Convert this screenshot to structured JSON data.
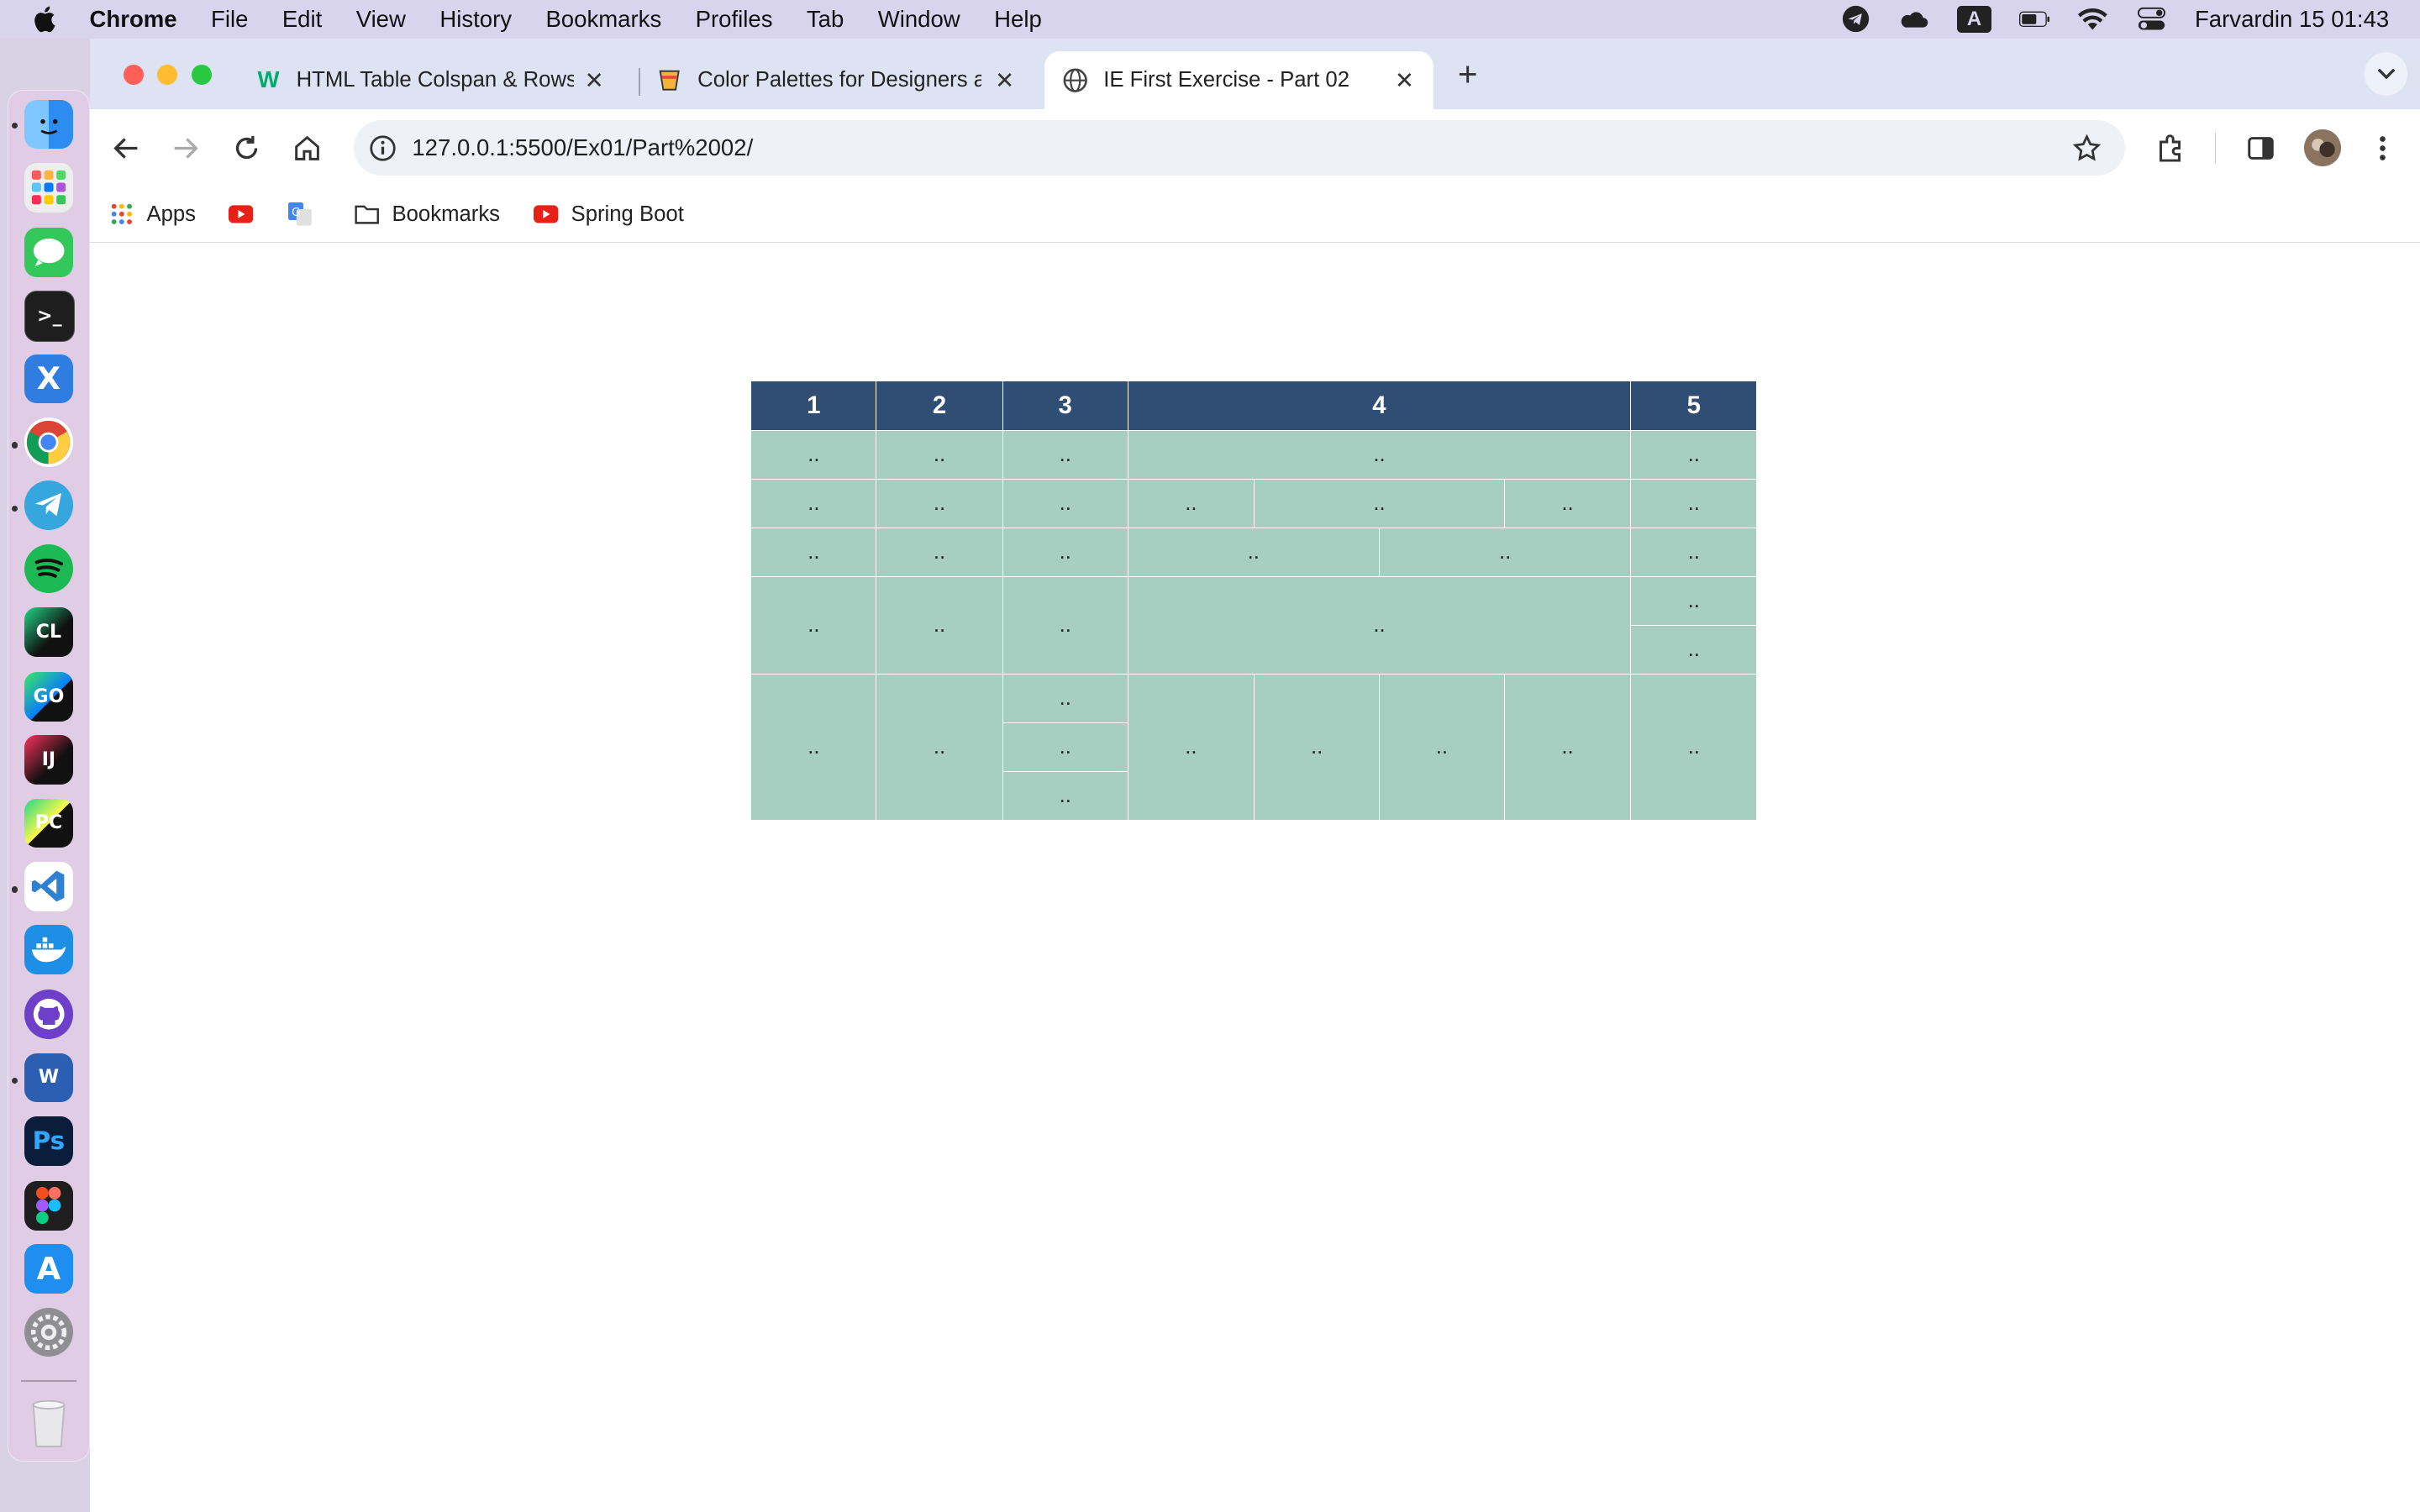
{
  "menubar": {
    "items": [
      "Chrome",
      "File",
      "Edit",
      "View",
      "History",
      "Bookmarks",
      "Profiles",
      "Tab",
      "Window",
      "Help"
    ],
    "clock": "Farvardin 15  01:43",
    "input_source": "A"
  },
  "dock": {
    "apps": [
      {
        "name": "Finder",
        "label": "",
        "color": "#2d8cf0"
      },
      {
        "name": "Launchpad",
        "label": "",
        "color": "#e9e9e9"
      },
      {
        "name": "Messages",
        "label": "",
        "color": "#34c759"
      },
      {
        "name": "Terminal",
        "label": ">_",
        "color": "#1e1e1e"
      },
      {
        "name": "Xcode-like",
        "label": "X",
        "color": "#2f7de1"
      },
      {
        "name": "Chrome",
        "label": "",
        "color": "#ffffff"
      },
      {
        "name": "Telegram",
        "label": "",
        "color": "#35a6de"
      },
      {
        "name": "Spotify",
        "label": "",
        "color": "#1db954"
      },
      {
        "name": "CLion",
        "label": "CL",
        "color": "#111111"
      },
      {
        "name": "GoLand",
        "label": "GO",
        "color": "#111111"
      },
      {
        "name": "IntelliJ IDEA",
        "label": "IJ",
        "color": "#111111"
      },
      {
        "name": "PyCharm",
        "label": "PC",
        "color": "#111111"
      },
      {
        "name": "VS Code",
        "label": "",
        "color": "#2f80d1"
      },
      {
        "name": "Docker",
        "label": "",
        "color": "#1d8fe6"
      },
      {
        "name": "GitHub Desktop",
        "label": "",
        "color": "#6e40c9"
      },
      {
        "name": "Word",
        "label": "W",
        "color": "#2b5fb4"
      },
      {
        "name": "Photoshop",
        "label": "Ps",
        "color": "#0a1e3b"
      },
      {
        "name": "Figma",
        "label": "",
        "color": "#1e1e1e"
      },
      {
        "name": "App Store",
        "label": "A",
        "color": "#1f8ef1"
      },
      {
        "name": "System Settings",
        "label": "",
        "color": "#8e8e93"
      },
      {
        "name": "Trash",
        "label": "",
        "color": "#e8e8ea"
      }
    ]
  },
  "browser": {
    "tabs": [
      {
        "title": "HTML Table Colspan & Rowsp",
        "active": false
      },
      {
        "title": "Color Palettes for Designers a",
        "active": false
      },
      {
        "title": "IE First Exercise - Part 02",
        "active": true
      }
    ],
    "url": "127.0.0.1:5500/Ex01/Part%2002/",
    "bookmarks": [
      "Apps",
      "Bookmarks",
      "Spring Boot"
    ]
  },
  "table": {
    "headers": [
      "1",
      "2",
      "3",
      "4",
      "5"
    ],
    "cell_text": "..",
    "header_color": "#304e73",
    "cell_color": "#a6cfc2"
  }
}
